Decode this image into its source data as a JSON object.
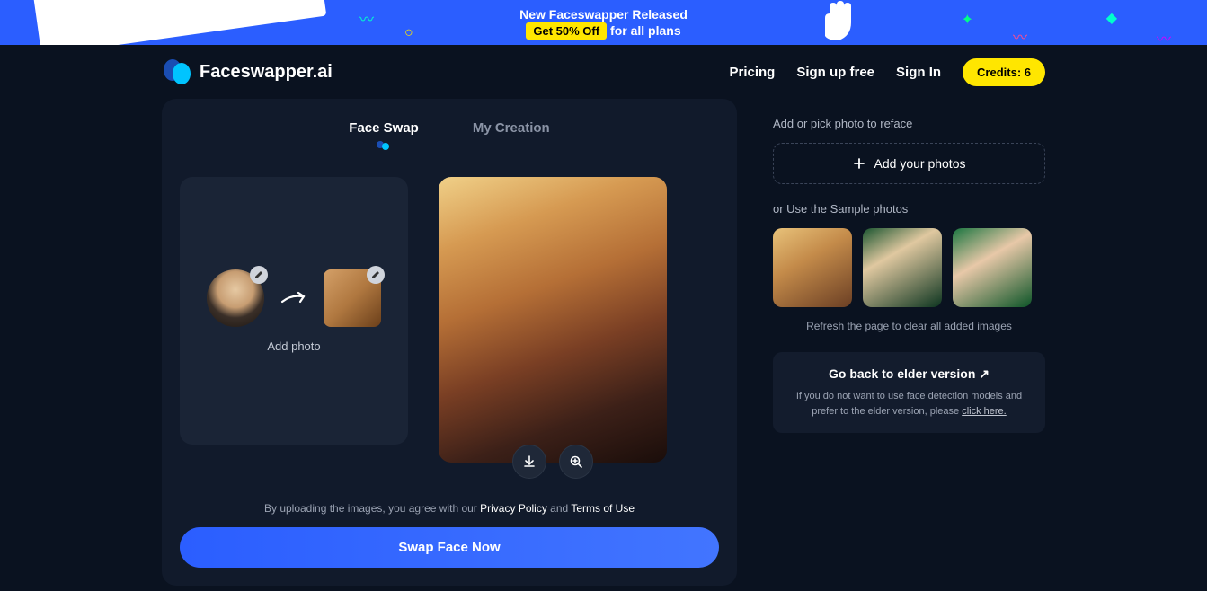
{
  "banner": {
    "line1": "New Faceswapper Released",
    "highlight": "Get 50% Off",
    "line2_suffix": "for all plans"
  },
  "header": {
    "brand": "Faceswapper.ai",
    "nav": {
      "pricing": "Pricing",
      "signup": "Sign up free",
      "signin": "Sign In"
    },
    "credits": "Credits: 6"
  },
  "tabs": {
    "face_swap": "Face Swap",
    "my_creation": "My Creation"
  },
  "upload": {
    "add_photo": "Add photo"
  },
  "terms": {
    "prefix": "By uploading the images, you agree with our ",
    "privacy": "Privacy Policy",
    "and": " and ",
    "tos": "Terms of Use"
  },
  "swap_button": "Swap Face Now",
  "right": {
    "add_or_pick": "Add or pick photo to reface",
    "add_your_photos": "Add your photos",
    "or_use": "or Use the Sample photos",
    "refresh_hint": "Refresh the page to clear all added images",
    "elder_title": "Go back to elder version ↗",
    "elder_desc_prefix": "If you do not want to use face detection models and prefer to the elder version, please ",
    "elder_link": "click here."
  }
}
